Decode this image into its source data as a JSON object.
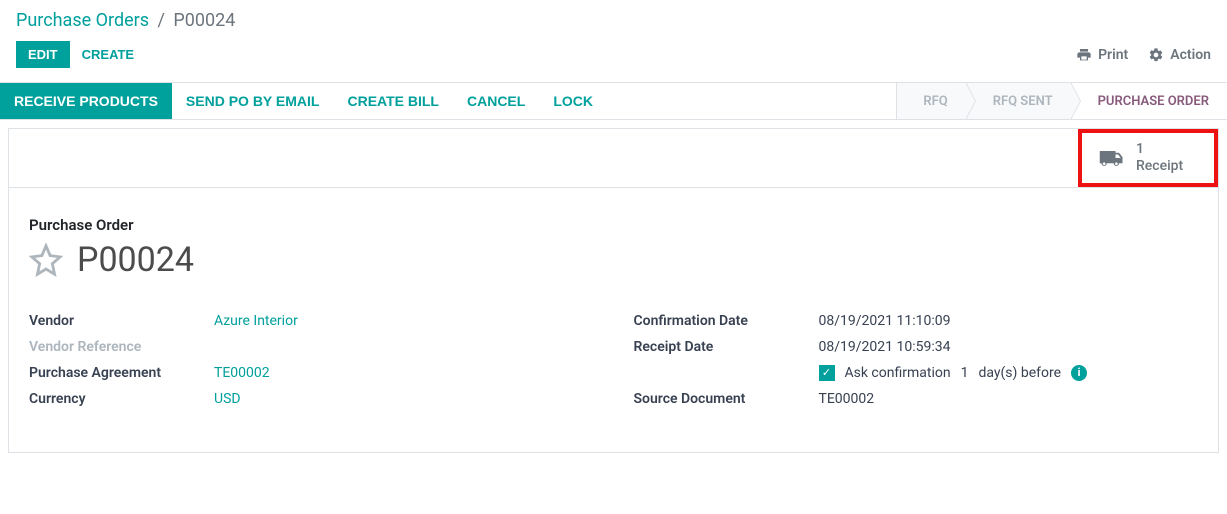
{
  "breadcrumb": {
    "parent": "Purchase Orders",
    "separator": "/",
    "current": "P00024"
  },
  "toolbar": {
    "edit": "EDIT",
    "create": "CREATE",
    "print": "Print",
    "action": "Action"
  },
  "status_actions": {
    "receive": "RECEIVE PRODUCTS",
    "send_email": "SEND PO BY EMAIL",
    "create_bill": "CREATE BILL",
    "cancel": "CANCEL",
    "lock": "LOCK"
  },
  "status_steps": {
    "rfq": "RFQ",
    "rfq_sent": "RFQ SENT",
    "purchase_order": "PURCHASE ORDER"
  },
  "stat": {
    "count": "1",
    "label": "Receipt"
  },
  "record": {
    "section_title": "Purchase Order",
    "name": "P00024"
  },
  "fields": {
    "vendor_label": "Vendor",
    "vendor_value": "Azure Interior",
    "vendor_ref_label": "Vendor Reference",
    "agreement_label": "Purchase Agreement",
    "agreement_value": "TE00002",
    "currency_label": "Currency",
    "currency_value": "USD",
    "confirm_date_label": "Confirmation Date",
    "confirm_date_value": "08/19/2021 11:10:09",
    "receipt_date_label": "Receipt Date",
    "receipt_date_value": "08/19/2021 10:59:34",
    "ask_confirm_prefix": "Ask confirmation",
    "ask_confirm_days": "1",
    "ask_confirm_suffix": "day(s) before",
    "source_doc_label": "Source Document",
    "source_doc_value": "TE00002"
  }
}
